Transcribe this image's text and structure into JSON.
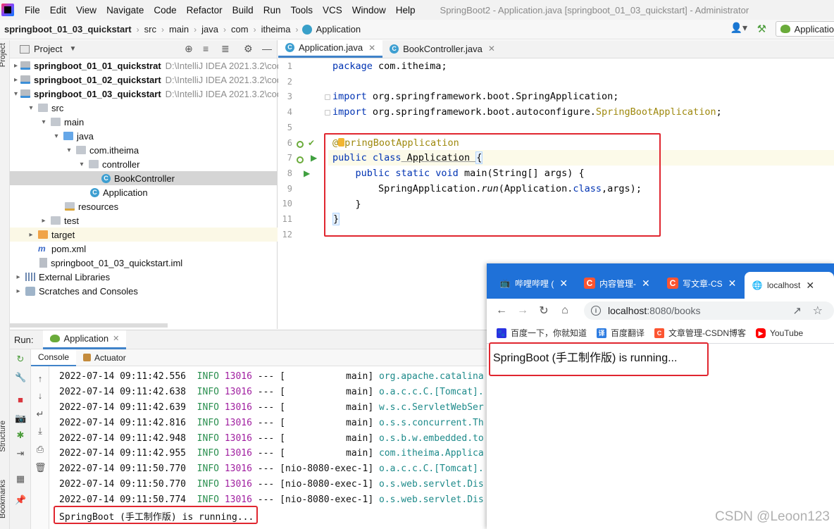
{
  "menu": {
    "items": [
      "File",
      "Edit",
      "View",
      "Navigate",
      "Code",
      "Refactor",
      "Build",
      "Run",
      "Tools",
      "VCS",
      "Window",
      "Help"
    ],
    "window_title": "SpringBoot2 - Application.java [springboot_01_03_quickstart] - Administrator"
  },
  "breadcrumb": {
    "items": [
      "springboot_01_03_quickstart",
      "src",
      "main",
      "java",
      "com",
      "itheima",
      "Application"
    ],
    "run_config": "Applicatio"
  },
  "sidebar_tabs": {
    "project": "Project",
    "structure": "Structure",
    "bookmarks": "Bookmarks"
  },
  "project": {
    "title": "Project",
    "tree": [
      {
        "name": "springboot_01_01_quickstrat",
        "path": "D:\\IntelliJ IDEA 2021.3.2\\cod"
      },
      {
        "name": "springboot_01_02_quickstart",
        "path": "D:\\IntelliJ IDEA 2021.3.2\\cod"
      },
      {
        "name": "springboot_01_03_quickstart",
        "path": "D:\\IntelliJ IDEA 2021.3.2\\cod"
      },
      {
        "name": "src"
      },
      {
        "name": "main"
      },
      {
        "name": "java"
      },
      {
        "name": "com.itheima"
      },
      {
        "name": "controller"
      },
      {
        "name": "BookController"
      },
      {
        "name": "Application"
      },
      {
        "name": "resources"
      },
      {
        "name": "test"
      },
      {
        "name": "target"
      },
      {
        "name": "pom.xml"
      },
      {
        "name": "springboot_01_03_quickstart.iml"
      },
      {
        "name": "External Libraries"
      },
      {
        "name": "Scratches and Consoles"
      }
    ]
  },
  "editor": {
    "tabs": [
      "Application.java",
      "BookController.java"
    ],
    "line_numbers": [
      "1",
      "2",
      "3",
      "4",
      "5",
      "6",
      "7",
      "8",
      "9",
      "10",
      "11",
      "12"
    ],
    "code": {
      "l1_kw": "package",
      "l1_rest": " com.itheima;",
      "l3_kw": "import",
      "l3_rest": " org.springframework.boot.SpringApplication;",
      "l4_kw": "import",
      "l4_rest": " org.springframework.boot.autoconfigure.",
      "l4_anno": "SpringBootApplication",
      "l4_end": ";",
      "l6_at": "@",
      "l6_anno": "pringBootApplication",
      "l7_kw": "public class",
      "l7_rest": " Application ",
      "l7_brace": "{",
      "l8_kw": "public static void",
      "l8_rest": " main(String[] args) {",
      "l9_pre": "SpringApplication.",
      "l9_method": "run",
      "l9_mid": "(Application.",
      "l9_kw": "class",
      "l9_end": ",args);",
      "l10": "}",
      "l11": "}"
    }
  },
  "run": {
    "label": "Run:",
    "tab": "Application",
    "subtabs": [
      "Console",
      "Actuator"
    ],
    "logs": [
      {
        "ts": "2022-07-14 09:11:42.556",
        "level": "INFO",
        "pid": "13016",
        "sep": "---",
        "thread": "[           main]",
        "cls": "org.apache.catalina"
      },
      {
        "ts": "2022-07-14 09:11:42.638",
        "level": "INFO",
        "pid": "13016",
        "sep": "---",
        "thread": "[           main]",
        "cls": "o.a.c.c.C.[Tomcat]."
      },
      {
        "ts": "2022-07-14 09:11:42.639",
        "level": "INFO",
        "pid": "13016",
        "sep": "---",
        "thread": "[           main]",
        "cls": "w.s.c.ServletWebSer"
      },
      {
        "ts": "2022-07-14 09:11:42.816",
        "level": "INFO",
        "pid": "13016",
        "sep": "---",
        "thread": "[           main]",
        "cls": "o.s.s.concurrent.Th"
      },
      {
        "ts": "2022-07-14 09:11:42.948",
        "level": "INFO",
        "pid": "13016",
        "sep": "---",
        "thread": "[           main]",
        "cls": "o.s.b.w.embedded.to"
      },
      {
        "ts": "2022-07-14 09:11:42.955",
        "level": "INFO",
        "pid": "13016",
        "sep": "---",
        "thread": "[           main]",
        "cls": "com.itheima.Applica"
      },
      {
        "ts": "2022-07-14 09:11:50.770",
        "level": "INFO",
        "pid": "13016",
        "sep": "---",
        "thread": "[nio-8080-exec-1]",
        "cls": "o.a.c.c.C.[Tomcat]."
      },
      {
        "ts": "2022-07-14 09:11:50.770",
        "level": "INFO",
        "pid": "13016",
        "sep": "---",
        "thread": "[nio-8080-exec-1]",
        "cls": "o.s.web.servlet.Dis"
      },
      {
        "ts": "2022-07-14 09:11:50.774",
        "level": "INFO",
        "pid": "13016",
        "sep": "---",
        "thread": "[nio-8080-exec-1]",
        "cls": "o.s.web.servlet.Dis"
      }
    ],
    "output": "SpringBoot (手工制作版) is running..."
  },
  "browser": {
    "tabs": [
      {
        "title": "哔哩哔哩 (",
        "icon": "bilibili-icon"
      },
      {
        "title": "内容管理-",
        "icon": "csdn-icon"
      },
      {
        "title": "写文章-CS",
        "icon": "csdn-icon"
      },
      {
        "title": "localhost",
        "icon": "globe-icon"
      }
    ],
    "url_host": "localhost",
    "url_path": ":8080/books",
    "bookmarks": [
      "百度一下，你就知道",
      "百度翻译",
      "文章管理-CSDN博客",
      "YouTube"
    ],
    "page_text": "SpringBoot (手工制作版) is running..."
  },
  "watermark": "CSDN @Leoon123",
  "colors": {
    "highlight": "#e0262f",
    "chrome_blue": "#1f71d8",
    "accent": "#4083c9"
  }
}
